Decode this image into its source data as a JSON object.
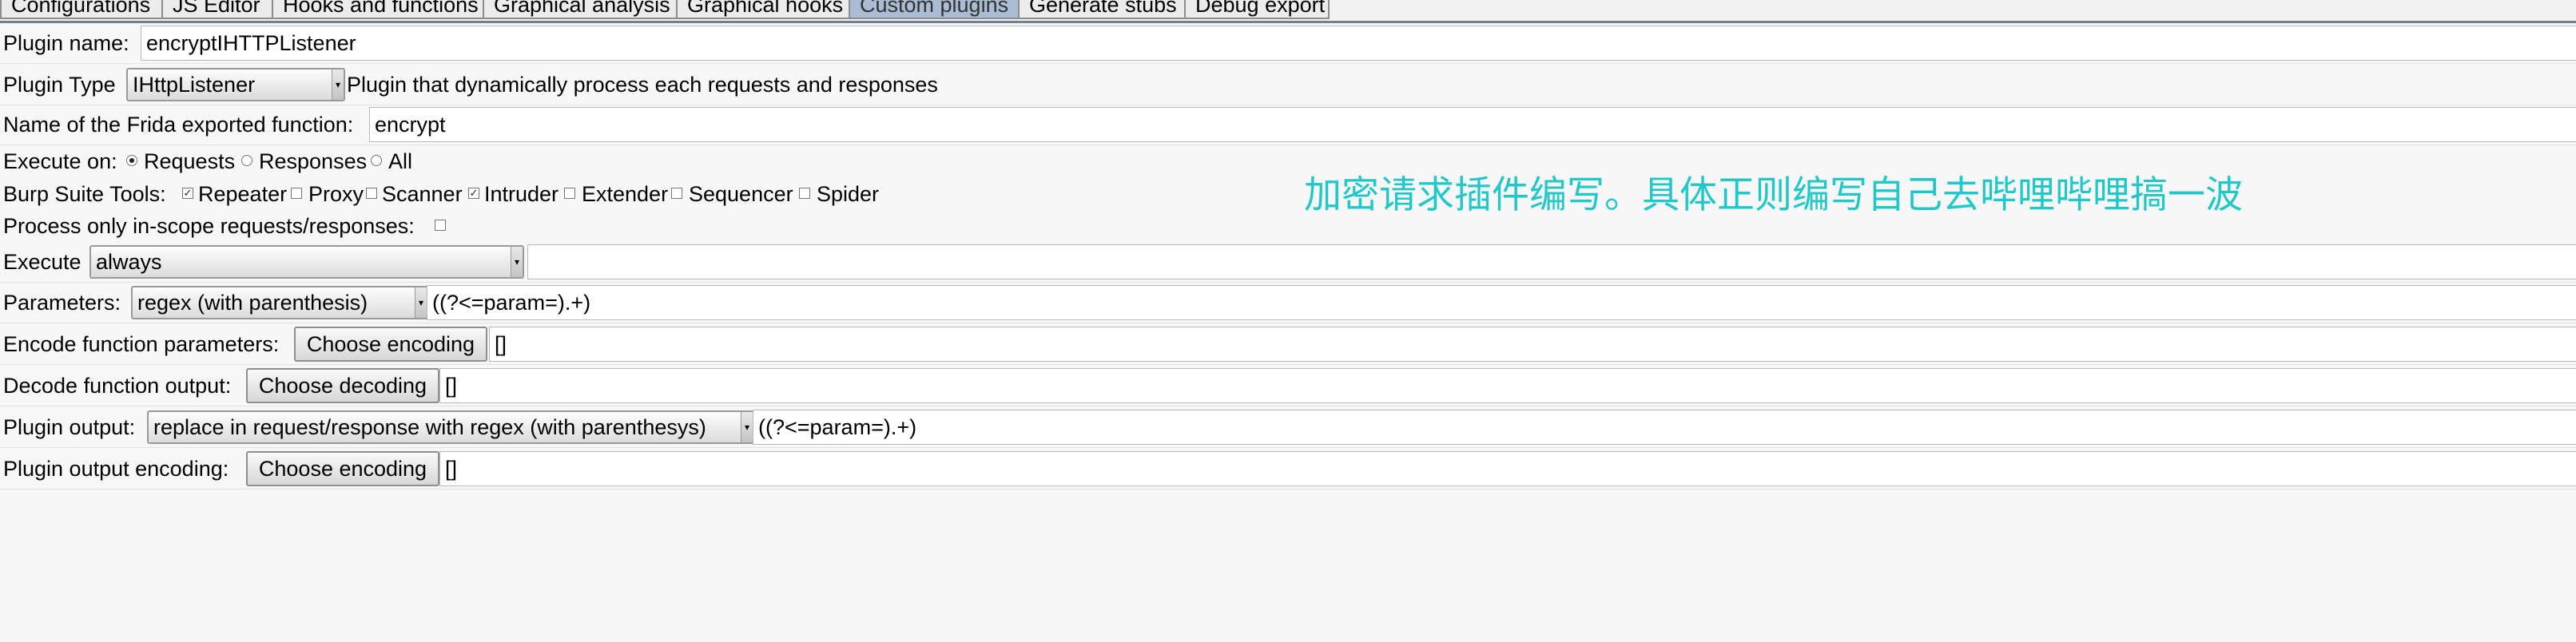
{
  "tabs": [
    "Configurations",
    "JS Editor",
    "Hooks and functions",
    "Graphical analysis",
    "Graphical hooks",
    "Custom plugins",
    "Generate stubs",
    "Debug export"
  ],
  "active_tab": "Custom plugins",
  "plugin_name": {
    "label": "Plugin name:",
    "value": "encryptIHTTPListener"
  },
  "plugin_type": {
    "label": "Plugin Type",
    "selected": "IHttpListener",
    "description": "Plugin that dynamically process each requests and responses"
  },
  "frida_function": {
    "label": "Name of the Frida exported function:",
    "value": "encrypt"
  },
  "execute_on": {
    "label": "Execute on:",
    "options": [
      {
        "label": "Requests",
        "checked": true
      },
      {
        "label": "Responses",
        "checked": false
      },
      {
        "label": "All",
        "checked": false
      }
    ]
  },
  "burp_tools": {
    "label": "Burp Suite Tools:",
    "options": [
      {
        "label": "Repeater",
        "checked": true
      },
      {
        "label": "Proxy",
        "checked": false
      },
      {
        "label": "Scanner",
        "checked": true
      },
      {
        "label": "Intruder",
        "checked": false
      },
      {
        "label": "Extender",
        "checked": false
      },
      {
        "label": "Sequencer",
        "checked": false
      },
      {
        "label": "Spider",
        "checked": false
      }
    ]
  },
  "in_scope": {
    "label": "Process only in-scope requests/responses:",
    "checked": false
  },
  "execute": {
    "label": "Execute",
    "selected": "always",
    "value": ""
  },
  "parameters": {
    "label": "Parameters:",
    "selected": "regex (with parenthesis)",
    "value": "((?<=param=).+)"
  },
  "encode_params": {
    "label": "Encode function parameters:",
    "button": "Choose encoding",
    "value": "[]"
  },
  "decode_output": {
    "label": "Decode function output:",
    "button": "Choose decoding",
    "value": "[]"
  },
  "plugin_output": {
    "label": "Plugin output:",
    "selected": "replace in request/response with regex (with parenthesys)",
    "value": "((?<=param=).+)"
  },
  "output_encoding": {
    "label": "Plugin output encoding:",
    "button": "Choose encoding",
    "value": "[]"
  },
  "annotation": "加密请求插件编写。具体正则编写自己去哔哩哔哩搞一波",
  "colors": {
    "annotation": "#22c8c8",
    "active_tab": "#a9bcd4"
  }
}
